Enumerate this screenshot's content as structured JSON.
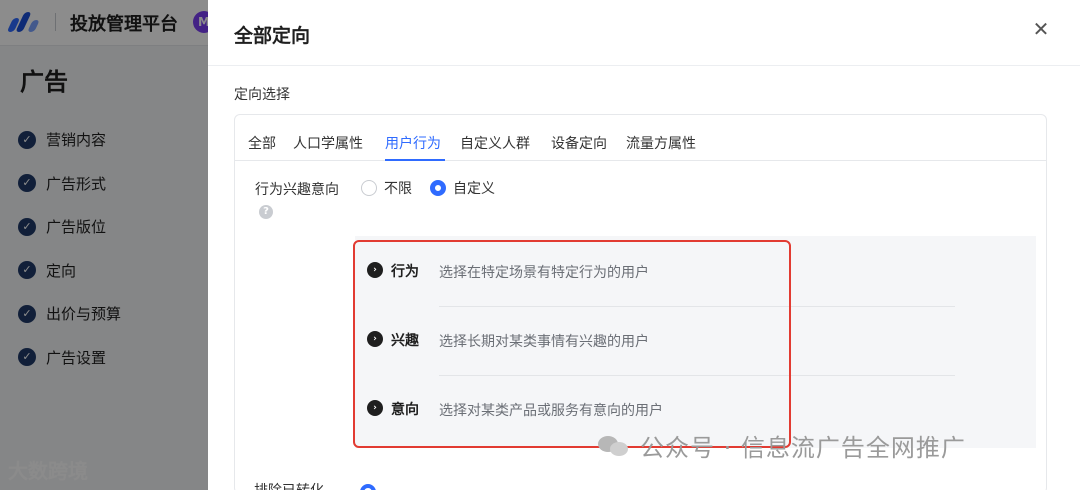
{
  "app": {
    "platform_title": "投放管理平台",
    "badge": "M"
  },
  "sidebar": {
    "title": "广告",
    "steps": [
      {
        "label": "营销内容"
      },
      {
        "label": "广告形式"
      },
      {
        "label": "广告版位"
      },
      {
        "label": "定向"
      },
      {
        "label": "出价与预算"
      },
      {
        "label": "广告设置"
      }
    ]
  },
  "drawer": {
    "title": "全部定向",
    "close_glyph": "✕",
    "section_label": "定向选择",
    "tabs": [
      {
        "label": "全部",
        "active": false
      },
      {
        "label": "人口学属性",
        "active": false
      },
      {
        "label": "用户行为",
        "active": true
      },
      {
        "label": "自定义人群",
        "active": false
      },
      {
        "label": "设备定向",
        "active": false
      },
      {
        "label": "流量方属性",
        "active": false
      }
    ],
    "field": {
      "label": "行为兴趣意向",
      "help_glyph": "?",
      "options": [
        {
          "label": "不限",
          "checked": false
        },
        {
          "label": "自定义",
          "checked": true
        }
      ]
    },
    "targeting_options": [
      {
        "name": "行为",
        "desc": "选择在特定场景有特定行为的用户"
      },
      {
        "name": "兴趣",
        "desc": "选择长期对某类事情有兴趣的用户"
      },
      {
        "name": "意向",
        "desc": "选择对某类产品或服务有意向的用户"
      }
    ],
    "bottom_label": "排除已转化"
  },
  "watermarks": {
    "bottom_left": "大数跨境",
    "bottom_right": "公众号 · 信息流广告全网推广"
  },
  "colors": {
    "accent": "#2f6bff",
    "highlight_border": "#e23b32"
  },
  "icons": {
    "option_arrow": "›",
    "step_check": "✓"
  }
}
